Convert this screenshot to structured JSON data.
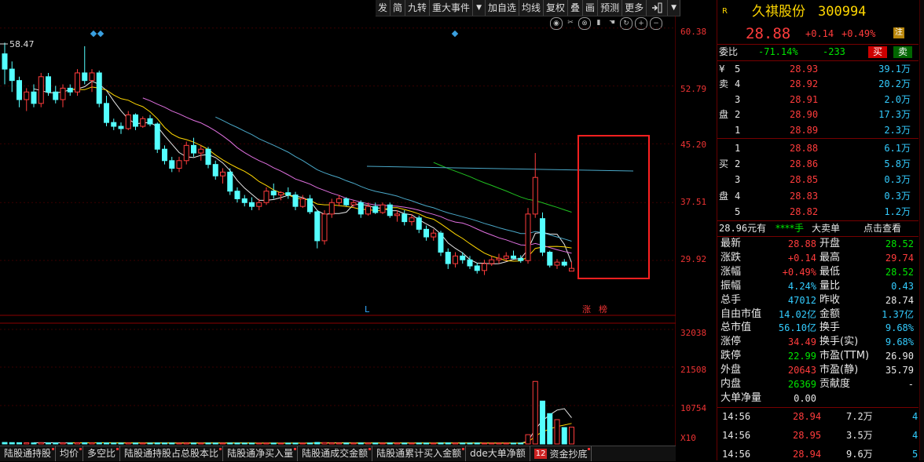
{
  "toolbar": [
    "发",
    "简",
    "九转",
    "重大事件",
    "加自选",
    "均线",
    "复权",
    "叠",
    "画",
    "预测",
    "更多"
  ],
  "price_axis": [
    "60.38",
    "52.79",
    "45.20",
    "37.51",
    "29.92"
  ],
  "volume_axis": [
    "32038",
    "21508",
    "10754",
    "X10"
  ],
  "chart_labels": {
    "high_mark": "58.47",
    "l_mark": "L",
    "zhang": "涨",
    "bang": "榜"
  },
  "bottom_tabs": [
    "陆股通持股",
    "均价",
    "多空比",
    "陆股通持股占总股本比",
    "陆股通净买入量",
    "陆股通成交金额",
    "陆股通累计买入金额",
    "dde大单净额",
    "资金抄底"
  ],
  "bottom_badge": "12",
  "stock": {
    "flag": "R",
    "name": "久祺股份",
    "code": "300994",
    "price": "28.88",
    "change": "+0.14",
    "pct": "+0.49%",
    "badge": "注"
  },
  "weibi": {
    "label": "委比",
    "pct": "-71.14%",
    "diff": "-233",
    "buy_btn": "买",
    "sell_btn": "卖"
  },
  "sell_side_label": [
    "¥",
    "卖",
    "",
    "盘",
    ""
  ],
  "sell_levels": [
    {
      "lv": "5",
      "price": "28.93",
      "vol": "39.1万"
    },
    {
      "lv": "4",
      "price": "28.92",
      "vol": "20.2万"
    },
    {
      "lv": "3",
      "price": "28.91",
      "vol": "2.0万"
    },
    {
      "lv": "2",
      "price": "28.90",
      "vol": "17.3万"
    },
    {
      "lv": "1",
      "price": "28.89",
      "vol": "2.3万"
    }
  ],
  "buy_side_label": [
    "",
    "买",
    "",
    "盘",
    ""
  ],
  "buy_levels": [
    {
      "lv": "1",
      "price": "28.88",
      "vol": "6.1万"
    },
    {
      "lv": "2",
      "price": "28.86",
      "vol": "5.8万"
    },
    {
      "lv": "3",
      "price": "28.85",
      "vol": "0.3万"
    },
    {
      "lv": "4",
      "price": "28.83",
      "vol": "0.3万"
    },
    {
      "lv": "5",
      "price": "28.82",
      "vol": "1.2万"
    }
  ],
  "big_order": {
    "price": "28.96元有",
    "stars": "****手",
    "label": "大卖单",
    "action": "点击查看"
  },
  "stats": [
    {
      "l1": "最新",
      "v1": "28.88",
      "c1": "red",
      "l2": "开盘",
      "v2": "28.52",
      "c2": "grn"
    },
    {
      "l1": "涨跌",
      "v1": "+0.14",
      "c1": "red",
      "l2": "最高",
      "v2": "29.74",
      "c2": "red"
    },
    {
      "l1": "涨幅",
      "v1": "+0.49%",
      "c1": "red",
      "l2": "最低",
      "v2": "28.52",
      "c2": "grn"
    },
    {
      "l1": "振幅",
      "v1": "4.24%",
      "c1": "cy",
      "l2": "量比",
      "v2": "0.43",
      "c2": "cy"
    },
    {
      "l1": "总手",
      "v1": "47012",
      "c1": "cy",
      "l2": "昨收",
      "v2": "28.74",
      "c2": "wht"
    },
    {
      "l1": "自由市值",
      "v1": "14.02亿",
      "c1": "cy",
      "l2": "金额",
      "v2": "1.37亿",
      "c2": "cy"
    },
    {
      "l1": "总市值",
      "v1": "56.10亿",
      "c1": "cy",
      "l2": "换手",
      "v2": "9.68%",
      "c2": "cy"
    },
    {
      "l1": "涨停",
      "v1": "34.49",
      "c1": "red",
      "l2": "换手(实)",
      "v2": "9.68%",
      "c2": "cy"
    },
    {
      "l1": "跌停",
      "v1": "22.99",
      "c1": "grn",
      "l2": "市盈(TTM)",
      "v2": "26.90",
      "c2": "wht"
    },
    {
      "l1": "外盘",
      "v1": "20643",
      "c1": "red",
      "l2": "市盈(静)",
      "v2": "35.79",
      "c2": "wht"
    },
    {
      "l1": "内盘",
      "v1": "26369",
      "c1": "grn",
      "l2": "贡献度",
      "v2": "-",
      "c2": "wht"
    },
    {
      "l1": "大单净量",
      "v1": "0.00",
      "c1": "wht",
      "l2": "",
      "v2": "",
      "c2": "wht"
    }
  ],
  "ticks": [
    {
      "time": "14:56",
      "price": "28.94",
      "vol": "7.2万",
      "n": "4"
    },
    {
      "time": "14:56",
      "price": "28.95",
      "vol": "3.5万",
      "n": "4"
    },
    {
      "time": "14:56",
      "price": "28.94",
      "vol": "9.6万",
      "n": "5"
    }
  ],
  "chart_data": {
    "type": "candlestick",
    "y_axis_ticks": [
      60.38,
      52.79,
      45.2,
      37.51,
      29.92
    ],
    "ylim": [
      25.5,
      62.0
    ],
    "high_marker": 58.47,
    "candles": [
      [
        57.0,
        58.47,
        53.0,
        55.0
      ],
      [
        55.0,
        56.0,
        52.0,
        53.5
      ],
      [
        53.5,
        54.0,
        50.0,
        51.0
      ],
      [
        51.0,
        52.5,
        49.5,
        52.0
      ],
      [
        52.0,
        53.0,
        50.0,
        50.5
      ],
      [
        50.5,
        54.5,
        50.0,
        54.0
      ],
      [
        54.0,
        54.5,
        51.5,
        52.0
      ],
      [
        52.0,
        52.8,
        50.5,
        51.0
      ],
      [
        51.0,
        53.0,
        50.0,
        52.5
      ],
      [
        52.5,
        53.0,
        51.5,
        52.0
      ],
      [
        52.0,
        55.0,
        51.5,
        54.5
      ],
      [
        54.5,
        58.0,
        53.0,
        53.5
      ],
      [
        53.5,
        55.0,
        52.0,
        54.5
      ],
      [
        54.5,
        54.8,
        50.0,
        50.5
      ],
      [
        50.5,
        51.5,
        47.5,
        48.0
      ],
      [
        48.0,
        48.5,
        47.0,
        47.5
      ],
      [
        47.5,
        48.0,
        46.5,
        47.2
      ],
      [
        47.2,
        49.5,
        47.0,
        49.0
      ],
      [
        49.0,
        49.2,
        47.0,
        47.5
      ],
      [
        47.5,
        48.8,
        47.3,
        48.5
      ],
      [
        48.5,
        49.0,
        47.5,
        47.8
      ],
      [
        47.8,
        48.0,
        44.0,
        44.5
      ],
      [
        44.5,
        45.0,
        42.5,
        43.0
      ],
      [
        43.0,
        43.5,
        41.5,
        42.0
      ],
      [
        42.0,
        43.5,
        41.5,
        43.0
      ],
      [
        43.0,
        45.5,
        42.5,
        45.0
      ],
      [
        45.0,
        46.0,
        43.5,
        44.0
      ],
      [
        44.0,
        45.0,
        43.0,
        44.5
      ],
      [
        44.5,
        44.8,
        42.0,
        42.5
      ],
      [
        42.5,
        43.0,
        40.5,
        41.0
      ],
      [
        41.0,
        42.0,
        40.0,
        41.5
      ],
      [
        41.5,
        42.0,
        38.5,
        39.0
      ],
      [
        39.0,
        39.5,
        37.5,
        38.0
      ],
      [
        38.0,
        38.5,
        37.0,
        37.5
      ],
      [
        37.5,
        38.2,
        36.5,
        37.0
      ],
      [
        37.0,
        38.0,
        36.5,
        37.5
      ],
      [
        37.5,
        39.5,
        37.2,
        39.0
      ],
      [
        39.0,
        40.0,
        38.0,
        38.5
      ],
      [
        38.5,
        39.0,
        37.8,
        38.8
      ],
      [
        38.8,
        39.5,
        38.0,
        38.5
      ],
      [
        38.5,
        38.9,
        36.5,
        37.0
      ],
      [
        37.0,
        38.5,
        36.8,
        38.0
      ],
      [
        38.0,
        38.5,
        36.0,
        36.3
      ],
      [
        36.3,
        36.5,
        31.5,
        32.5
      ],
      [
        32.5,
        36.5,
        32.0,
        36.0
      ],
      [
        36.0,
        38.0,
        35.5,
        37.5
      ],
      [
        37.5,
        38.5,
        37.0,
        38.0
      ],
      [
        38.0,
        38.2,
        37.0,
        37.2
      ],
      [
        37.2,
        37.8,
        36.8,
        37.5
      ],
      [
        37.5,
        37.8,
        35.5,
        36.0
      ],
      [
        36.0,
        37.5,
        35.8,
        37.0
      ],
      [
        37.0,
        37.5,
        36.0,
        36.2
      ],
      [
        36.2,
        37.5,
        36.0,
        37.2
      ],
      [
        37.2,
        37.5,
        35.5,
        35.8
      ],
      [
        35.8,
        36.5,
        35.0,
        36.0
      ],
      [
        36.0,
        36.5,
        34.5,
        35.0
      ],
      [
        35.0,
        36.0,
        34.5,
        35.5
      ],
      [
        35.5,
        35.8,
        33.5,
        34.0
      ],
      [
        34.0,
        34.5,
        32.5,
        33.0
      ],
      [
        33.0,
        34.0,
        32.5,
        33.5
      ],
      [
        33.5,
        33.8,
        30.5,
        31.0
      ],
      [
        31.0,
        31.5,
        28.8,
        29.5
      ],
      [
        29.5,
        31.0,
        29.0,
        30.5
      ],
      [
        30.5,
        31.0,
        29.5,
        30.0
      ],
      [
        30.0,
        30.5,
        28.8,
        29.2
      ],
      [
        29.2,
        29.6,
        28.2,
        28.6
      ],
      [
        28.6,
        30.0,
        28.0,
        29.5
      ],
      [
        29.5,
        30.5,
        29.2,
        30.0
      ],
      [
        30.0,
        30.8,
        29.5,
        30.2
      ],
      [
        30.2,
        31.0,
        29.8,
        30.5
      ],
      [
        30.5,
        31.2,
        30.0,
        30.2
      ],
      [
        30.2,
        30.6,
        29.6,
        29.9
      ],
      [
        29.9,
        36.8,
        29.5,
        36.0
      ],
      [
        36.0,
        44.0,
        35.5,
        40.8
      ],
      [
        35.4,
        36.2,
        30.5,
        31.0
      ],
      [
        31.0,
        31.2,
        29.0,
        29.3
      ],
      [
        29.3,
        30.1,
        28.8,
        29.7
      ],
      [
        29.7,
        30.1,
        29.1,
        29.3
      ],
      [
        28.52,
        29.74,
        28.52,
        28.88
      ]
    ],
    "volumes": [
      420,
      380,
      360,
      340,
      300,
      350,
      320,
      300,
      310,
      290,
      330,
      360,
      310,
      340,
      300,
      280,
      260,
      290,
      270,
      260,
      250,
      300,
      270,
      260,
      250,
      280,
      260,
      250,
      270,
      260,
      250,
      270,
      250,
      240,
      230,
      240,
      260,
      250,
      230,
      240,
      250,
      240,
      260,
      420,
      380,
      300,
      270,
      250,
      260,
      280,
      270,
      260,
      250,
      270,
      260,
      250,
      240,
      260,
      250,
      240,
      280,
      300,
      260,
      250,
      240,
      260,
      230,
      240,
      250,
      240,
      230,
      250,
      2600,
      17500,
      12000,
      8500,
      6800,
      4600,
      4700
    ],
    "volume_ylim": [
      0,
      32038
    ]
  }
}
